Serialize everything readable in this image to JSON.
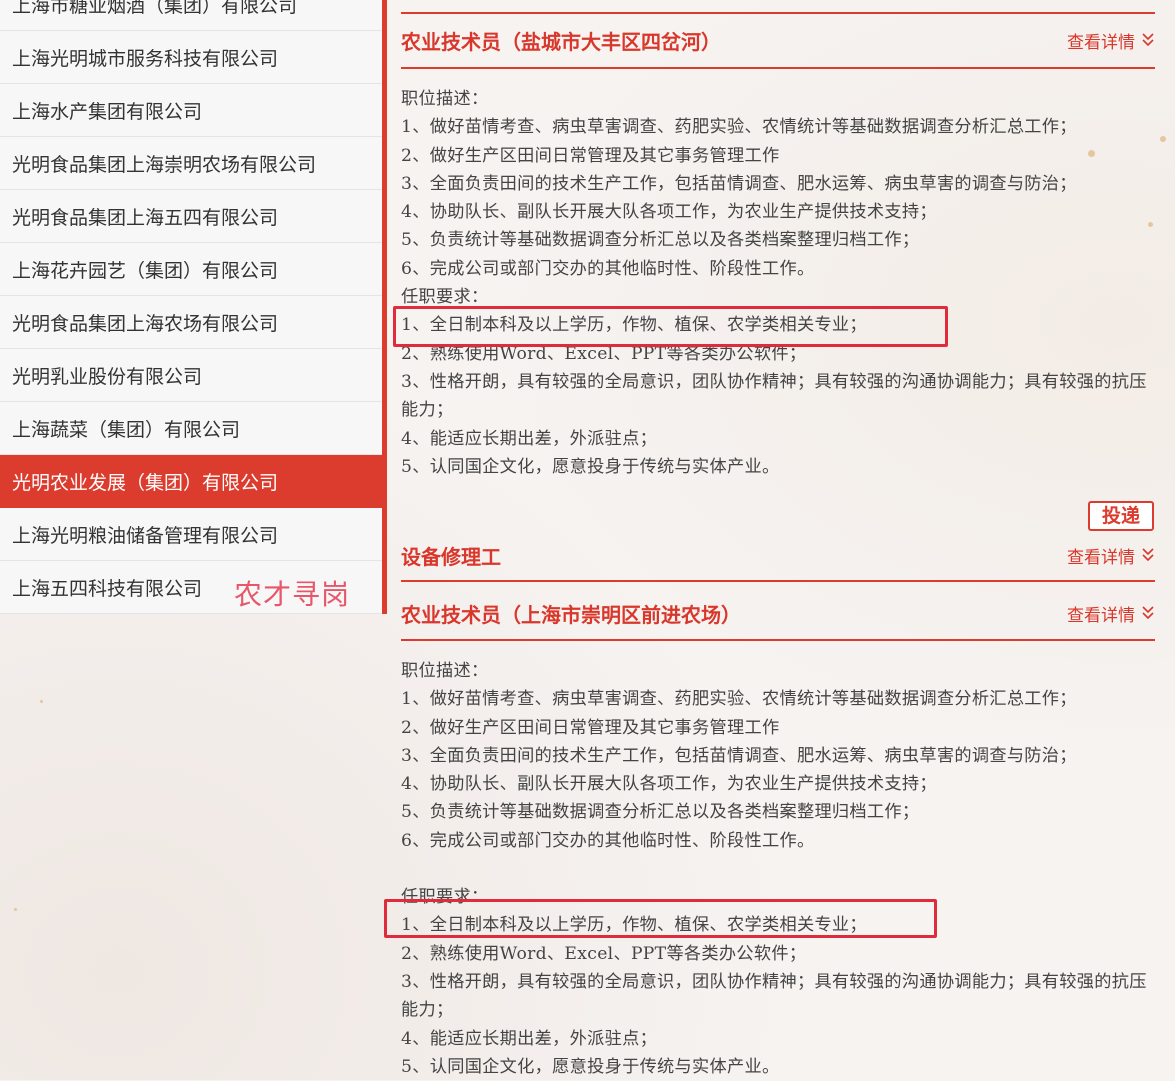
{
  "sidebar": {
    "items": [
      {
        "label": "上海市糖业烟酒（集团）有限公司",
        "active": false
      },
      {
        "label": "上海光明城市服务科技有限公司",
        "active": false
      },
      {
        "label": "上海水产集团有限公司",
        "active": false
      },
      {
        "label": "光明食品集团上海崇明农场有限公司",
        "active": false
      },
      {
        "label": "光明食品集团上海五四有限公司",
        "active": false
      },
      {
        "label": "上海花卉园艺（集团）有限公司",
        "active": false
      },
      {
        "label": "光明食品集团上海农场有限公司",
        "active": false
      },
      {
        "label": "光明乳业股份有限公司",
        "active": false
      },
      {
        "label": "上海蔬菜（集团）有限公司",
        "active": false
      },
      {
        "label": "光明农业发展（集团）有限公司",
        "active": true
      },
      {
        "label": "上海光明粮油储备管理有限公司",
        "active": false
      },
      {
        "label": "上海五四科技有限公司",
        "active": false
      }
    ],
    "watermark": "农才寻岗"
  },
  "jobs": [
    {
      "title": "农业技术员（盐城市大丰区四岔河）",
      "detail_label": "查看详情",
      "desc_heading": "职位描述：",
      "desc": [
        "1、做好苗情考查、病虫草害调查、药肥实验、农情统计等基础数据调查分析汇总工作；",
        "2、做好生产区田间日常管理及其它事务管理工作",
        "3、全面负责田间的技术生产工作，包括苗情调查、肥水运筹、病虫草害的调查与防治；",
        "4、协助队长、副队长开展大队各项工作，为农业生产提供技术支持；",
        "5、负责统计等基础数据调查分析汇总以及各类档案整理归档工作；",
        "6、完成公司或部门交办的其他临时性、阶段性工作。"
      ],
      "req_heading": "任职要求：",
      "req": [
        "1、全日制本科及以上学历，作物、植保、农学类相关专业；",
        "2、熟练使用Word、Excel、PPT等各类办公软件；",
        "3、性格开朗，具有较强的全局意识，团队协作精神；具有较强的沟通协调能力；具有较强的抗压能力；",
        "4、能适应长期出差，外派驻点；",
        "5、认同国企文化，愿意投身于传统与实体产业。"
      ],
      "apply_label": "投递"
    },
    {
      "title": "设备修理工",
      "detail_label": "查看详情"
    },
    {
      "title": "农业技术员（上海市崇明区前进农场）",
      "detail_label": "查看详情",
      "desc_heading": "职位描述：",
      "desc": [
        "1、做好苗情考查、病虫草害调查、药肥实验、农情统计等基础数据调查分析汇总工作；",
        "2、做好生产区田间日常管理及其它事务管理工作",
        "3、全面负责田间的技术生产工作，包括苗情调查、肥水运筹、病虫草害的调查与防治；",
        "4、协助队长、副队长开展大队各项工作，为农业生产提供技术支持；",
        "5、负责统计等基础数据调查分析汇总以及各类档案整理归档工作；",
        "6、完成公司或部门交办的其他临时性、阶段性工作。"
      ],
      "req_heading": "任职要求：",
      "req": [
        "1、全日制本科及以上学历，作物、植保、农学类相关专业；",
        "2、熟练使用Word、Excel、PPT等各类办公软件；",
        "3、性格开朗，具有较强的全局意识，团队协作精神；具有较强的沟通协调能力；具有较强的抗压能力；",
        "4、能适应长期出差，外派驻点；",
        "5、认同国企文化，愿意投身于传统与实体产业。"
      ]
    }
  ],
  "icons": {
    "detail": "chevron-double-down-icon"
  },
  "colors": {
    "accent": "#dc3c2e",
    "highlight": "#e02b3c",
    "watermark": "#e8566a"
  }
}
